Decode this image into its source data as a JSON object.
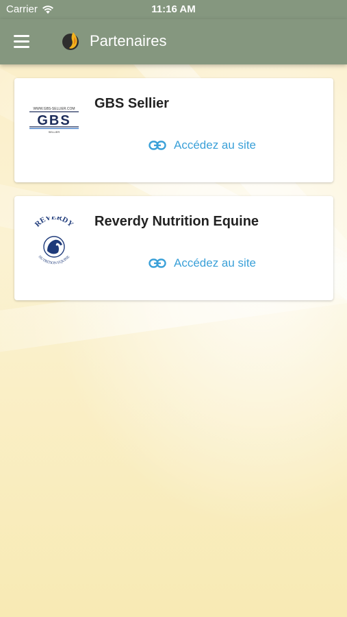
{
  "status_bar": {
    "carrier": "Carrier",
    "time": "11:16 AM",
    "wifi_icon": "wifi-icon"
  },
  "app_bar": {
    "title": "Partenaires",
    "menu_icon": "hamburger-menu-icon",
    "logo_icon": "app-logo-icon",
    "color": "#85977f"
  },
  "partners": [
    {
      "name": "GBS Sellier",
      "logo": "gbs-sellier-logo",
      "logo_text": "GBS",
      "logo_small_top": "WWW.GBS-SELLIER.COM",
      "logo_small_bottom": "SELLIER",
      "link_label": "Accédez au site",
      "link_icon": "link-icon"
    },
    {
      "name": "Reverdy Nutrition Equine",
      "logo": "reverdy-logo",
      "logo_text_top": "REVERDY",
      "logo_text_bottom": "NUTRITION EQUINE",
      "link_label": "Accédez au site",
      "link_icon": "link-icon"
    }
  ],
  "colors": {
    "link": "#3aa0d8",
    "background": "#fbefc0"
  }
}
